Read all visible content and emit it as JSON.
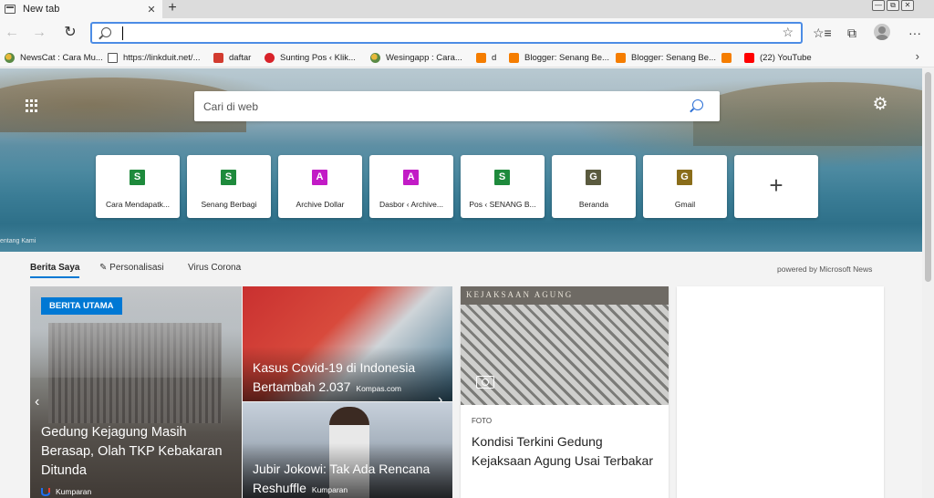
{
  "tab": {
    "title": "New tab",
    "close": "✕"
  },
  "window": {
    "minimize": "—",
    "restore": "⧉",
    "close": "✕"
  },
  "toolbar": {
    "back": "←",
    "forward": "→",
    "refresh": "↻",
    "favorite": "☆",
    "favorites_list": "☆≡",
    "collections": "⧉",
    "more": "···"
  },
  "address": {
    "value": "",
    "placeholder": ""
  },
  "bookmarks": [
    {
      "label": "NewsCat : Cara Mu...",
      "icon": "globe-icon"
    },
    {
      "label": "https://linkduit.net/...",
      "icon": "doc-icon"
    },
    {
      "label": "daftar",
      "icon": "pdf-icon"
    },
    {
      "label": "Sunting Pos ‹ Klik...",
      "icon": "red-icon"
    },
    {
      "label": "Wesingapp : Cara...",
      "icon": "globe-icon"
    },
    {
      "label": "d",
      "icon": "blogger-icon"
    },
    {
      "label": "Blogger: Senang Be...",
      "icon": "blogger-icon"
    },
    {
      "label": "Blogger: Senang Be...",
      "icon": "blogger-icon"
    },
    {
      "label": "",
      "icon": "blogger-icon"
    },
    {
      "label": "(22) YouTube",
      "icon": "youtube-icon"
    }
  ],
  "hero": {
    "search_placeholder": "Cari di web",
    "credit": "entang Kami",
    "tiles": [
      {
        "letter": "S",
        "label": "Cara Mendapatk...",
        "color": "#1e8a3c"
      },
      {
        "letter": "S",
        "label": "Senang Berbagi",
        "color": "#1e8a3c"
      },
      {
        "letter": "A",
        "label": "Archive Dollar",
        "color": "#c21bc6"
      },
      {
        "letter": "A",
        "label": "Dasbor ‹ Archive...",
        "color": "#c21bc6"
      },
      {
        "letter": "S",
        "label": "Pos ‹ SENANG B...",
        "color": "#1e8a3c"
      },
      {
        "letter": "G",
        "label": "Beranda",
        "color": "#5a5a3e"
      },
      {
        "letter": "G",
        "label": "Gmail",
        "color": "#8a6d1a"
      }
    ],
    "add_tile": "+"
  },
  "news": {
    "tabs": [
      "Berita Saya",
      "Personalisasi",
      "Virus Corona"
    ],
    "powered_by": "powered by Microsoft News",
    "featured": {
      "badge": "BERITA UTAMA",
      "headline": "Gedung Kejagung Masih Berasap, Olah TKP Kebakaran Ditunda",
      "source": "Kumparan"
    },
    "covid": {
      "headline": "Kasus Covid-19 di Indonesia Bertambah 2.037",
      "source": "Kompas.com"
    },
    "jubir": {
      "headline": "Jubir Jokowi: Tak Ada Rencana Reshuffle",
      "source": "Kumparan"
    },
    "foto": {
      "kicker": "FOTO",
      "headline": "Kondisi Terkini Gedung Kejaksaan Agung Usai Terbakar",
      "sign": "KEJAKSAAN AGUNG"
    }
  }
}
